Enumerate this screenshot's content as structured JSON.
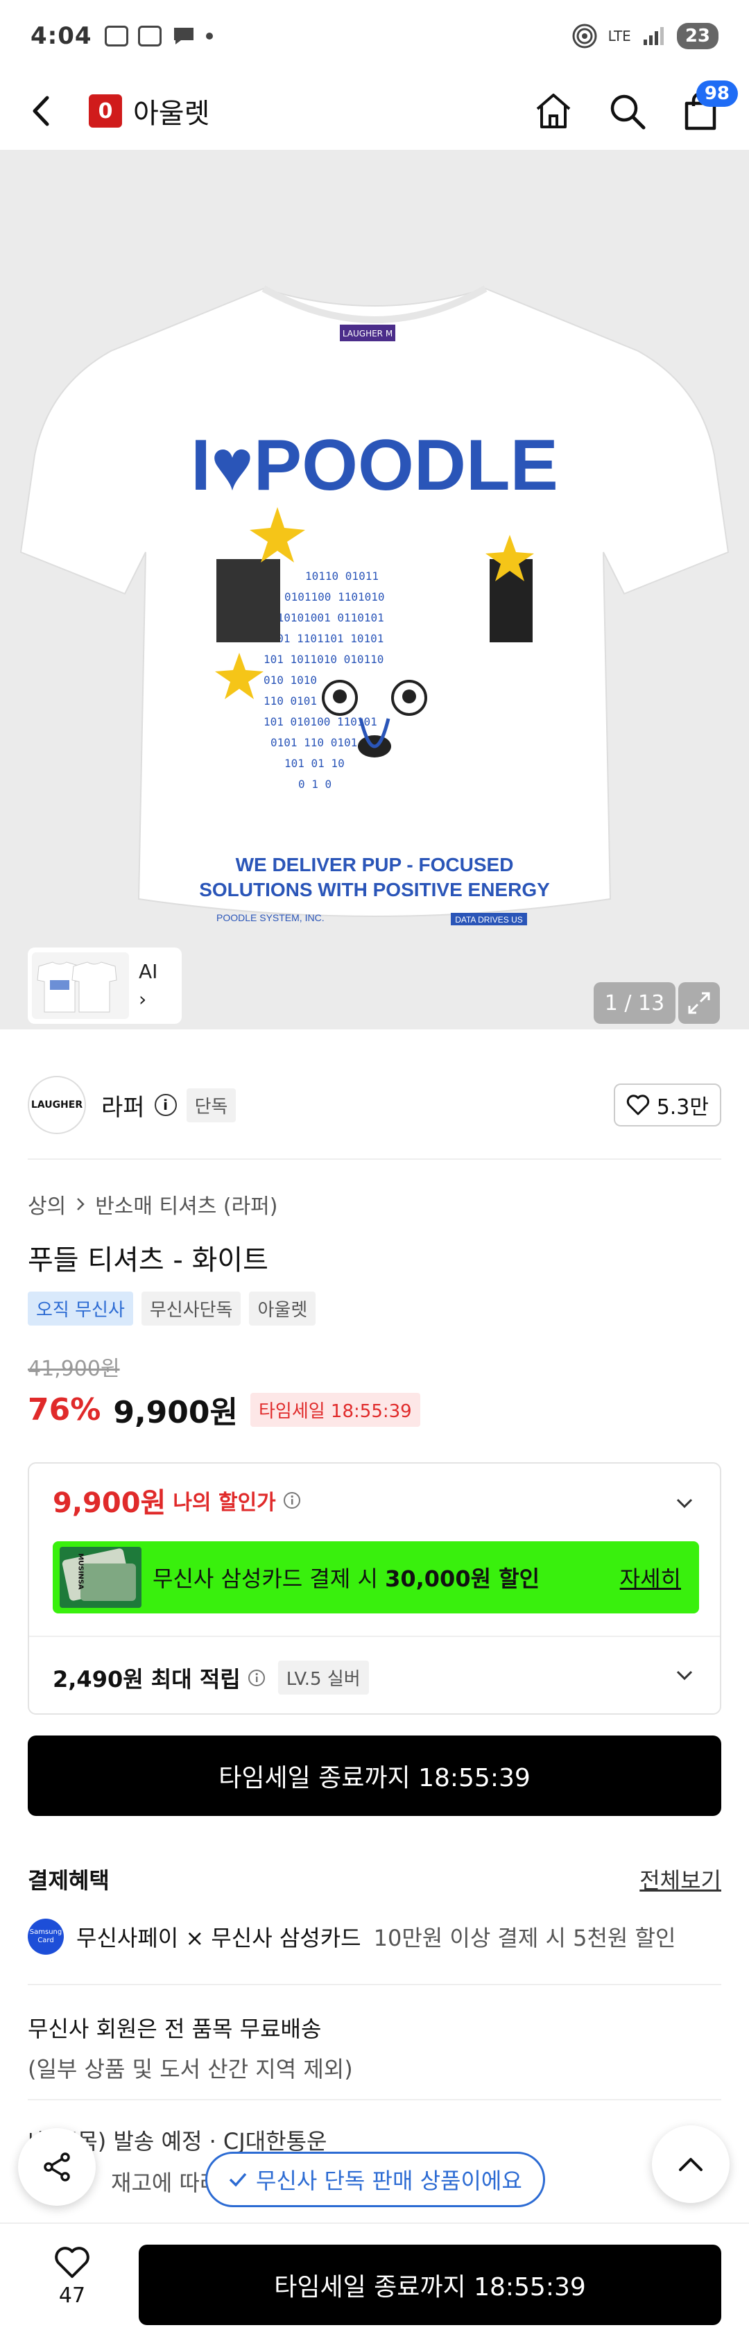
{
  "status_bar": {
    "time": "4:04",
    "network": "LTE",
    "battery": "23"
  },
  "header": {
    "brand_logo_letter": "0",
    "title": "아울렛",
    "cart_count": "98"
  },
  "gallery": {
    "print_heading": "I♥POODLE",
    "print_tagline_1": "WE DELIVER PUP - FOCUSED",
    "print_tagline_2": "SOLUTIONS WITH POSITIVE ENERGY",
    "print_footer_left": "POODLE SYSTEM, INC.",
    "print_footer_right": "DATA DRIVES US",
    "collar_label": "LAUGHER M",
    "thumbnail_label": "AI",
    "thumbnail_chevron": "›",
    "page_counter": "1 / 13"
  },
  "brand": {
    "logo_text": "LAUGHER",
    "name": "라퍼",
    "info": "i",
    "tag": "단독",
    "likes": "5.3만"
  },
  "product": {
    "breadcrumb": [
      "상의",
      "반소매 티셔츠 (라퍼)"
    ],
    "title": "푸들 티셔츠 - 화이트",
    "tags": [
      "오직 무신사",
      "무신사단독",
      "아울렛"
    ],
    "original_price": "41,900원",
    "discount": "76%",
    "price": "9,900원",
    "timesale_tag": "타임세일 18:55:39"
  },
  "benefit": {
    "my_price": "9,900원",
    "my_price_label": "나의 할인가",
    "banner_card_text": "MUSINSA",
    "banner_text": "무신사 삼성카드 결제 시 ",
    "banner_amount": "30,000원 할인",
    "banner_link": "자세히",
    "points_amount": "2,490원 최대 적립",
    "level_tag": "LV.5 실버"
  },
  "cta": {
    "label": "타임세일 종료까지 18:55:39"
  },
  "payment": {
    "title": "결제혜택",
    "see_all": "전체보기",
    "card_icon_text": "Samsung Card",
    "row_main": "무신사페이 × 무신사 삼성카드",
    "row_detail": "10만원 이상 결제 시 5천원 할인"
  },
  "shipping": {
    "line1": "무신사 회원은 전 품목 무료배송",
    "line2": "(일부 상품 및 도서 산간 지역 제외)",
    "dispatch": "내일(목) 발송 예정 · CJ대한통운",
    "stock": "재고에 따라"
  },
  "floating": {
    "exclusive_pill": "무신사 단독 판매 상품이에요"
  },
  "bottom_bar": {
    "like_count": "47",
    "cta_label": "타임세일 종료까지 18:55:39"
  }
}
